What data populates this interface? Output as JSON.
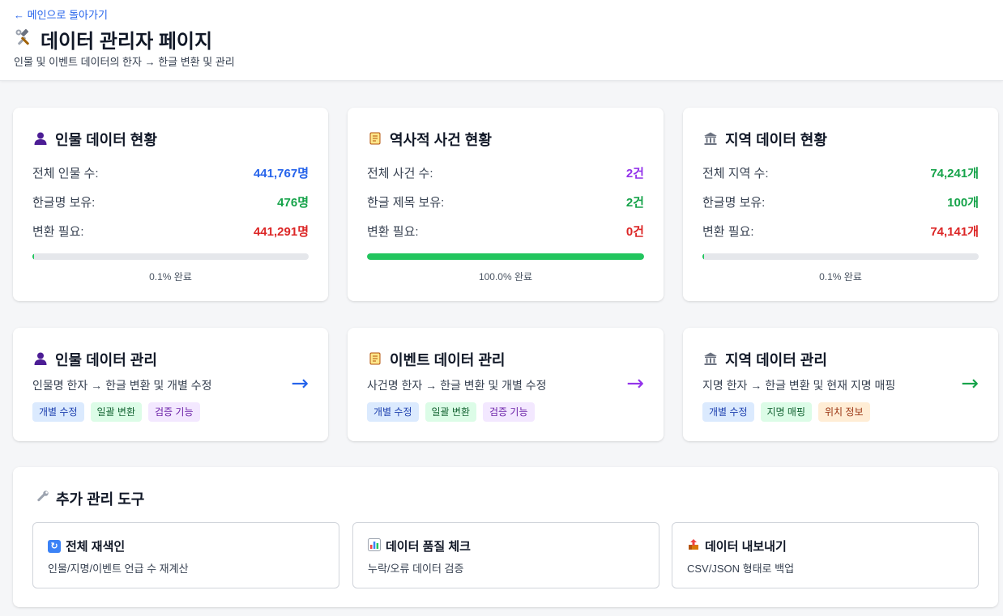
{
  "header": {
    "back_link": "← 메인으로 돌아가기",
    "title": "데이터 관리자 페이지",
    "title_icon": "hammer-wrench-icon",
    "subtitle": "인물 및 이벤트 데이터의 한자 → 한글 변환 및 관리"
  },
  "stats": [
    {
      "title": "인물 데이터 현황",
      "icon": "person-icon",
      "rows": [
        {
          "label": "전체 인물 수:",
          "value": "441,767명",
          "color": "#2563eb"
        },
        {
          "label": "한글명 보유:",
          "value": "476명",
          "color": "#16a34a"
        },
        {
          "label": "변환 필요:",
          "value": "441,291명",
          "color": "#dc2626"
        }
      ],
      "progress": 0.1,
      "progress_text": "0.1% 완료"
    },
    {
      "title": "역사적 사건 현황",
      "icon": "scroll-icon",
      "rows": [
        {
          "label": "전체 사건 수:",
          "value": "2건",
          "color": "#9333ea"
        },
        {
          "label": "한글 제목 보유:",
          "value": "2건",
          "color": "#16a34a"
        },
        {
          "label": "변환 필요:",
          "value": "0건",
          "color": "#dc2626"
        }
      ],
      "progress": 100,
      "progress_text": "100.0% 완료"
    },
    {
      "title": "지역 데이터 현황",
      "icon": "building-icon",
      "rows": [
        {
          "label": "전체 지역 수:",
          "value": "74,241개",
          "color": "#16a34a"
        },
        {
          "label": "한글명 보유:",
          "value": "100개",
          "color": "#16a34a"
        },
        {
          "label": "변환 필요:",
          "value": "74,141개",
          "color": "#dc2626"
        }
      ],
      "progress": 0.1,
      "progress_text": "0.1% 완료"
    }
  ],
  "management": [
    {
      "title": "인물 데이터 관리",
      "icon": "person-icon",
      "desc": "인물명 한자 → 한글 변환 및 개별 수정",
      "arrow": "→",
      "arrow_color": "#2563eb",
      "tags": [
        "개별 수정",
        "일괄 변환",
        "검증 기능"
      ]
    },
    {
      "title": "이벤트 데이터 관리",
      "icon": "scroll-icon",
      "desc": "사건명 한자 → 한글 변환 및 개별 수정",
      "arrow": "→",
      "arrow_color": "#9333ea",
      "tags": [
        "개별 수정",
        "일괄 변환",
        "검증 기능"
      ]
    },
    {
      "title": "지역 데이터 관리",
      "icon": "building-icon",
      "desc": "지명 한자 → 한글 변환 및 현재 지명 매핑",
      "arrow": "→",
      "arrow_color": "#16a34a",
      "tags": [
        "개별 수정",
        "지명 매핑",
        "위치 정보"
      ]
    }
  ],
  "tools": {
    "title": "추가 관리 도구",
    "icon": "wrench-icon",
    "items": [
      {
        "title": "전체 재색인",
        "desc": "인물/지명/이벤트 언급 수 재계산",
        "icon": "refresh-icon"
      },
      {
        "title": "데이터 품질 체크",
        "desc": "누락/오류 데이터 검증",
        "icon": "bar-chart-icon"
      },
      {
        "title": "데이터 내보내기",
        "desc": "CSV/JSON 형태로 백업",
        "icon": "export-icon"
      }
    ]
  }
}
